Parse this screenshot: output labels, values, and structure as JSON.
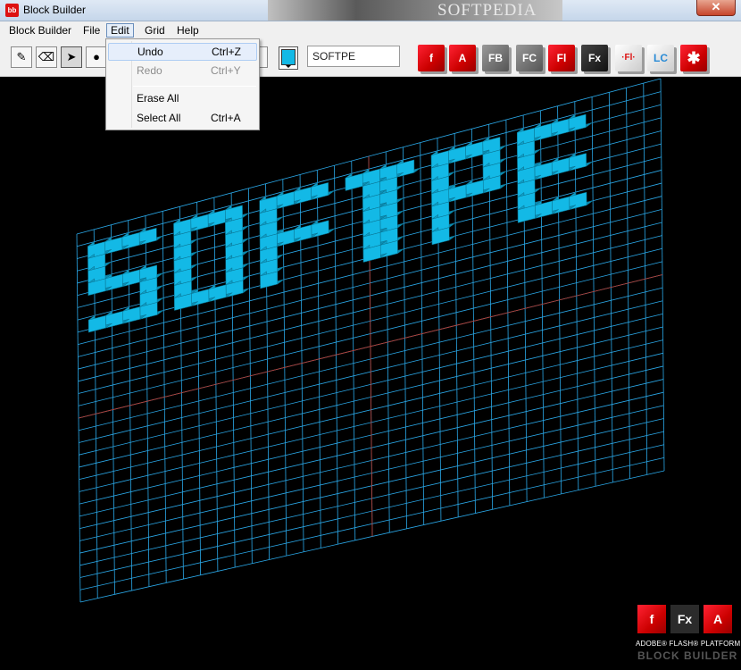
{
  "window": {
    "title": "Block Builder",
    "banner_text": "SOFTPEDIA",
    "close_glyph": "✕",
    "app_icon_glyph": "bb"
  },
  "menubar": {
    "items": [
      {
        "label": "Block Builder"
      },
      {
        "label": "File"
      },
      {
        "label": "Edit"
      },
      {
        "label": "Grid"
      },
      {
        "label": "Help"
      }
    ]
  },
  "edit_menu": {
    "items": [
      {
        "label": "Undo",
        "shortcut": "Ctrl+Z",
        "enabled": true
      },
      {
        "label": "Redo",
        "shortcut": "Ctrl+Y",
        "enabled": false
      },
      {
        "label": "Erase All",
        "shortcut": "",
        "enabled": true
      },
      {
        "label": "Select All",
        "shortcut": "Ctrl+A",
        "enabled": true
      }
    ]
  },
  "toolbar": {
    "tools": [
      {
        "icon": "pencil-icon",
        "glyph": "✎"
      },
      {
        "icon": "eraser-icon",
        "glyph": "⌫"
      },
      {
        "icon": "pointer-icon",
        "glyph": "➤"
      },
      {
        "icon": "sphere-icon",
        "glyph": "●"
      }
    ],
    "block_color": "#13b9e6",
    "text_value": "SOFTPE",
    "product_icons": [
      {
        "name": "flash-icon",
        "label": "f",
        "style": "red"
      },
      {
        "name": "acrobat-icon",
        "label": "A",
        "style": "red"
      },
      {
        "name": "flash-builder-icon",
        "label": "FB",
        "style": "gray"
      },
      {
        "name": "flash-catalyst-icon",
        "label": "FC",
        "style": "gray"
      },
      {
        "name": "flash-ide-icon",
        "label": "Fl",
        "style": "red"
      },
      {
        "name": "flex-icon",
        "label": "Fx",
        "style": "dark"
      },
      {
        "name": "flash-lite-icon",
        "label": "·Fl·",
        "style": "white"
      },
      {
        "name": "livecycle-icon",
        "label": "LC",
        "style": "white"
      },
      {
        "name": "adobe-logo-icon",
        "label": "✱",
        "style": "red"
      }
    ]
  },
  "canvas": {
    "grid_color": "#2aa8e8",
    "block_color": "#13b9e6",
    "axis_color": "#c0392b"
  },
  "logo": {
    "boxes": [
      {
        "name": "flash-logo-icon",
        "label": "f"
      },
      {
        "name": "flex-logo-icon",
        "label": "Fx"
      },
      {
        "name": "air-logo-icon",
        "label": "A"
      }
    ],
    "line1": "ADOBE® FLASH® PLATFORM",
    "line2": "BLOCK BUILDER"
  }
}
